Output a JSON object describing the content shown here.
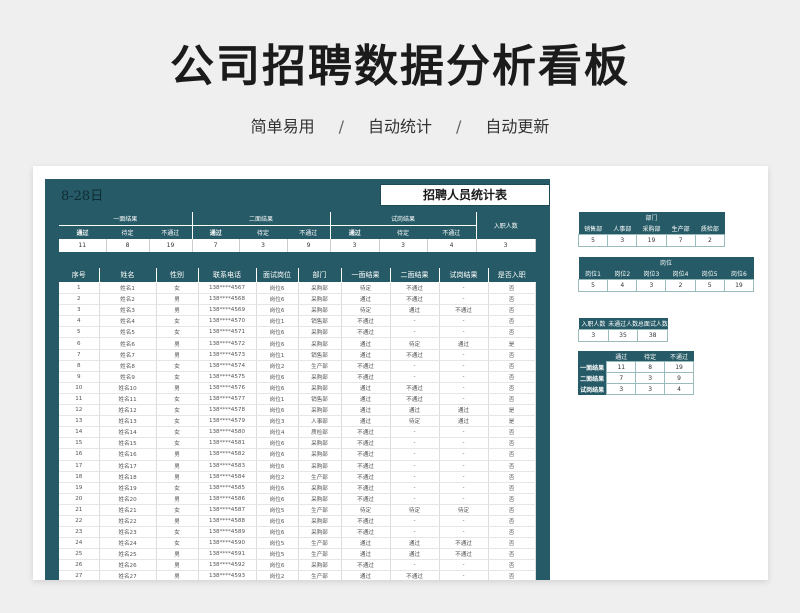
{
  "hero": {
    "title": "公司招聘数据分析看板",
    "sub": [
      "简单易用",
      "自动统计",
      "自动更新"
    ],
    "sep": "/"
  },
  "sheet": {
    "date": "8-28日",
    "title": "招聘人员统计表",
    "summary": {
      "groups": [
        "一面结果",
        "二面结果",
        "试岗结果",
        "入职人数"
      ],
      "headers": [
        "通过",
        "待定",
        "不通过",
        "通过",
        "待定",
        "不通过",
        "通过",
        "待定",
        "不通过"
      ],
      "values": [
        "11",
        "8",
        "19",
        "7",
        "3",
        "9",
        "3",
        "3",
        "4",
        "3"
      ]
    },
    "columns": [
      "序号",
      "姓名",
      "性别",
      "联系电话",
      "面试岗位",
      "部门",
      "一面结果",
      "二面结果",
      "试岗结果",
      "是否入职"
    ],
    "rows": [
      [
        "1",
        "姓名1",
        "女",
        "138****4567",
        "岗位6",
        "采购部",
        "待定",
        "不通过",
        "-",
        "否"
      ],
      [
        "2",
        "姓名2",
        "男",
        "138****4568",
        "岗位6",
        "采购部",
        "通过",
        "不通过",
        "-",
        "否"
      ],
      [
        "3",
        "姓名3",
        "男",
        "138****4569",
        "岗位6",
        "采购部",
        "待定",
        "通过",
        "不通过",
        "否"
      ],
      [
        "4",
        "姓名4",
        "女",
        "138****4570",
        "岗位1",
        "销售部",
        "不通过",
        "-",
        "-",
        "否"
      ],
      [
        "5",
        "姓名5",
        "女",
        "138****4571",
        "岗位6",
        "采购部",
        "不通过",
        "-",
        "-",
        "否"
      ],
      [
        "6",
        "姓名6",
        "男",
        "138****4572",
        "岗位6",
        "采购部",
        "通过",
        "待定",
        "通过",
        "是"
      ],
      [
        "7",
        "姓名7",
        "男",
        "138****4573",
        "岗位1",
        "销售部",
        "通过",
        "不通过",
        "-",
        "否"
      ],
      [
        "8",
        "姓名8",
        "女",
        "138****4574",
        "岗位2",
        "生产部",
        "不通过",
        "-",
        "-",
        "否"
      ],
      [
        "9",
        "姓名9",
        "女",
        "138****4575",
        "岗位6",
        "采购部",
        "不通过",
        "-",
        "-",
        "否"
      ],
      [
        "10",
        "姓名10",
        "男",
        "138****4576",
        "岗位6",
        "采购部",
        "通过",
        "不通过",
        "-",
        "否"
      ],
      [
        "11",
        "姓名11",
        "女",
        "138****4577",
        "岗位1",
        "销售部",
        "通过",
        "不通过",
        "-",
        "否"
      ],
      [
        "12",
        "姓名12",
        "女",
        "138****4578",
        "岗位6",
        "采购部",
        "通过",
        "通过",
        "通过",
        "是"
      ],
      [
        "13",
        "姓名13",
        "女",
        "138****4579",
        "岗位3",
        "人事部",
        "通过",
        "待定",
        "通过",
        "是"
      ],
      [
        "14",
        "姓名14",
        "女",
        "138****4580",
        "岗位4",
        "质检部",
        "不通过",
        "-",
        "-",
        "否"
      ],
      [
        "15",
        "姓名15",
        "女",
        "138****4581",
        "岗位6",
        "采购部",
        "不通过",
        "-",
        "-",
        "否"
      ],
      [
        "16",
        "姓名16",
        "男",
        "138****4582",
        "岗位6",
        "采购部",
        "不通过",
        "-",
        "-",
        "否"
      ],
      [
        "17",
        "姓名17",
        "男",
        "138****4583",
        "岗位6",
        "采购部",
        "不通过",
        "-",
        "-",
        "否"
      ],
      [
        "18",
        "姓名18",
        "男",
        "138****4584",
        "岗位2",
        "生产部",
        "不通过",
        "-",
        "-",
        "否"
      ],
      [
        "19",
        "姓名19",
        "女",
        "138****4585",
        "岗位6",
        "采购部",
        "不通过",
        "-",
        "-",
        "否"
      ],
      [
        "20",
        "姓名20",
        "男",
        "138****4586",
        "岗位6",
        "采购部",
        "不通过",
        "-",
        "-",
        "否"
      ],
      [
        "21",
        "姓名21",
        "女",
        "138****4587",
        "岗位5",
        "生产部",
        "待定",
        "待定",
        "待定",
        "否"
      ],
      [
        "22",
        "姓名22",
        "男",
        "138****4588",
        "岗位6",
        "采购部",
        "不通过",
        "-",
        "-",
        "否"
      ],
      [
        "23",
        "姓名23",
        "女",
        "138****4589",
        "岗位6",
        "采购部",
        "不通过",
        "-",
        "-",
        "否"
      ],
      [
        "24",
        "姓名24",
        "女",
        "138****4590",
        "岗位5",
        "生产部",
        "通过",
        "通过",
        "不通过",
        "否"
      ],
      [
        "25",
        "姓名25",
        "男",
        "138****4591",
        "岗位5",
        "生产部",
        "通过",
        "通过",
        "不通过",
        "否"
      ],
      [
        "26",
        "姓名26",
        "男",
        "138****4592",
        "岗位6",
        "采购部",
        "不通过",
        "-",
        "-",
        "否"
      ],
      [
        "27",
        "姓名27",
        "男",
        "138****4593",
        "岗位2",
        "生产部",
        "通过",
        "不通过",
        "-",
        "否"
      ]
    ]
  },
  "dept_table": {
    "title": "部门",
    "headers": [
      "销售部",
      "人事部",
      "采购部",
      "生产部",
      "质检部"
    ],
    "values": [
      "5",
      "3",
      "19",
      "7",
      "2"
    ]
  },
  "post_table": {
    "title": "岗位",
    "headers": [
      "岗位1",
      "岗位2",
      "岗位3",
      "岗位4",
      "岗位5",
      "岗位6"
    ],
    "values": [
      "5",
      "4",
      "3",
      "2",
      "5",
      "19"
    ]
  },
  "entry_table": {
    "headers": [
      "入职人数",
      "未通过人数",
      "总面试人数"
    ],
    "values": [
      "3",
      "35",
      "38"
    ]
  },
  "result_table": {
    "headers": [
      "通过",
      "待定",
      "不通过"
    ],
    "rows": [
      {
        "label": "一面结果",
        "values": [
          "11",
          "8",
          "19"
        ]
      },
      {
        "label": "二面结果",
        "values": [
          "7",
          "3",
          "9"
        ]
      },
      {
        "label": "试岗结果",
        "values": [
          "3",
          "3",
          "4"
        ]
      }
    ]
  },
  "colors": {
    "panel": "#255a66",
    "page_bg": "#efefef",
    "sheet_bg": "#ffffff"
  }
}
